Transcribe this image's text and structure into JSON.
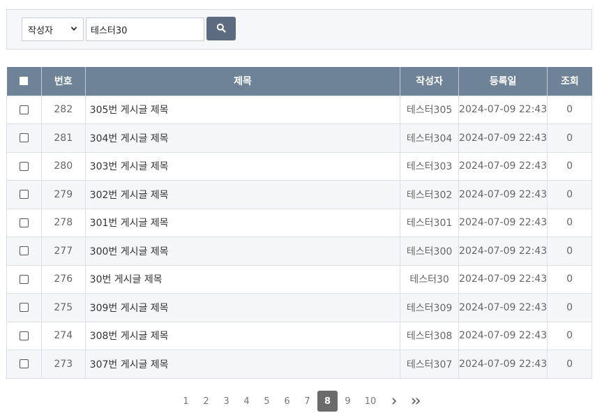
{
  "search": {
    "field_selected": "작성자",
    "query_value": "테스터30"
  },
  "table": {
    "headers": [
      "번호",
      "제목",
      "작성자",
      "등록일",
      "조회"
    ],
    "rows": [
      {
        "no": "282",
        "title": "305번 게시글 제목",
        "author": "테스터305",
        "date": "2024-07-09 22:43",
        "views": "0"
      },
      {
        "no": "281",
        "title": "304번 게시글 제목",
        "author": "테스터304",
        "date": "2024-07-09 22:43",
        "views": "0"
      },
      {
        "no": "280",
        "title": "303번 게시글 제목",
        "author": "테스터303",
        "date": "2024-07-09 22:43",
        "views": "0"
      },
      {
        "no": "279",
        "title": "302번 게시글 제목",
        "author": "테스터302",
        "date": "2024-07-09 22:43",
        "views": "0"
      },
      {
        "no": "278",
        "title": "301번 게시글 제목",
        "author": "테스터301",
        "date": "2024-07-09 22:43",
        "views": "0"
      },
      {
        "no": "277",
        "title": "300번 게시글 제목",
        "author": "테스터300",
        "date": "2024-07-09 22:43",
        "views": "0"
      },
      {
        "no": "276",
        "title": "30번 게시글 제목",
        "author": "테스터30",
        "date": "2024-07-09 22:43",
        "views": "0"
      },
      {
        "no": "275",
        "title": "309번 게시글 제목",
        "author": "테스터309",
        "date": "2024-07-09 22:43",
        "views": "0"
      },
      {
        "no": "274",
        "title": "308번 게시글 제목",
        "author": "테스터308",
        "date": "2024-07-09 22:43",
        "views": "0"
      },
      {
        "no": "273",
        "title": "307번 게시글 제목",
        "author": "테스터307",
        "date": "2024-07-09 22:43",
        "views": "0"
      }
    ]
  },
  "pagination": {
    "pages": [
      "1",
      "2",
      "3",
      "4",
      "5",
      "6",
      "7",
      "8",
      "9",
      "10"
    ],
    "current": "8"
  },
  "icons": {
    "search": "search-icon",
    "select_arrow": "chevron-down-icon",
    "next": "chevron-right-icon",
    "last": "double-chevron-right-icon"
  },
  "colors": {
    "header_bg": "#6e8397",
    "search_button_bg": "#5d6b80",
    "active_page_bg": "#6b6b6b",
    "row_alt_bg": "#f5f6f8"
  }
}
